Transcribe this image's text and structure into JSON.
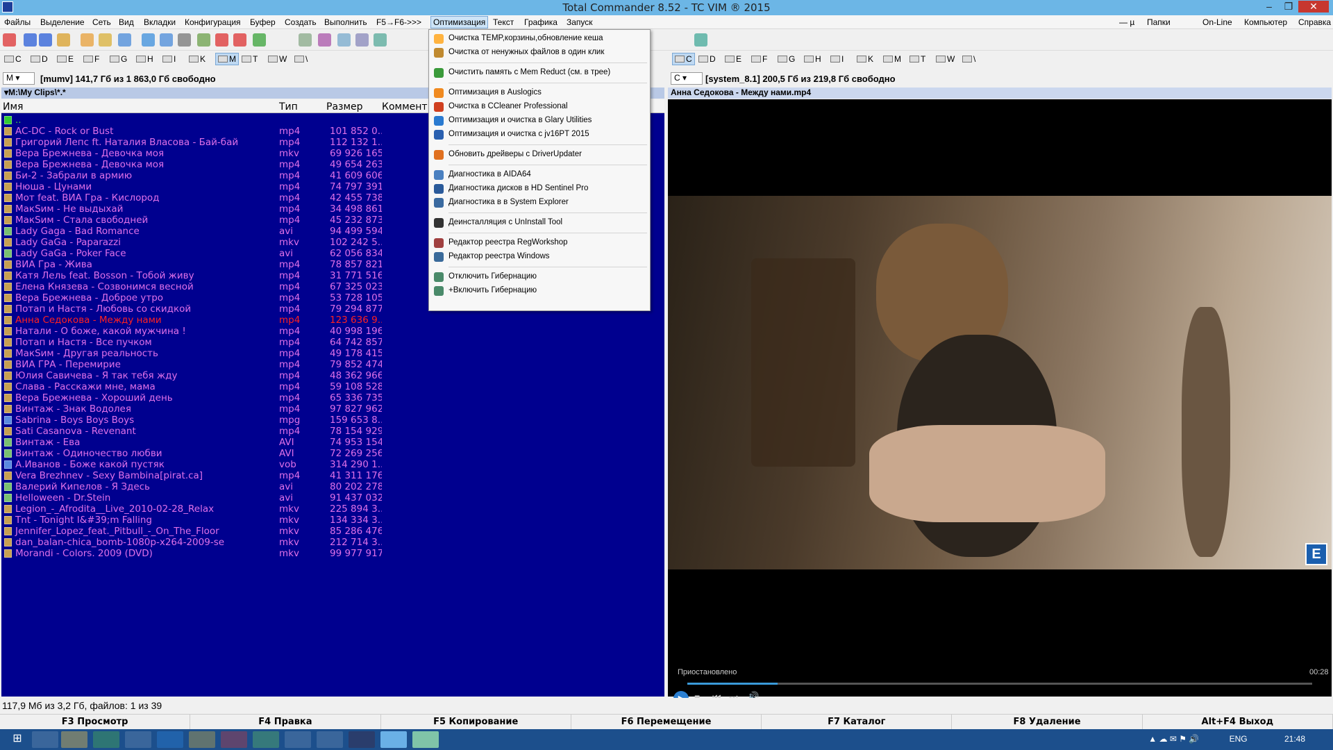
{
  "window": {
    "title": "Total Commander 8.52 - TC VIM ® 2015"
  },
  "menubar": {
    "left": [
      "Файлы",
      "Выделение",
      "Сеть",
      "Вид",
      "Вкладки",
      "Конфигурация",
      "Буфер",
      "Создать",
      "Выполнить",
      "F5→F6->>>",
      "Оптимизация",
      "Текст",
      "Графика",
      "Запуск"
    ],
    "right": [
      "— µ",
      "Папки",
      "On-Line",
      "Компьютер",
      "Справка"
    ]
  },
  "drives_left": [
    "C",
    "D",
    "E",
    "F",
    "G",
    "H",
    "I",
    "K",
    "M",
    "T",
    "W",
    "\\"
  ],
  "drives_right": [
    "C",
    "D",
    "E",
    "F",
    "G",
    "H",
    "I",
    "K",
    "M",
    "T",
    "W",
    "\\"
  ],
  "left_panel": {
    "drive": "M",
    "info": "[mumv]  141,7 Гб из 1 863,0 Гб свободно",
    "path": "▾M:\\My Clips\\*.*",
    "columns": {
      "name": "Имя",
      "type": "Тип",
      "size": "Размер",
      "comment": "Коммент"
    },
    "files": [
      {
        "name": "AC-DC - Rock or Bust",
        "type": "mp4",
        "size": "101 852 0.."
      },
      {
        "name": "Григорий Лепс ft. Наталия Власова - Бай-бай",
        "type": "mp4",
        "size": "112 132 1.."
      },
      {
        "name": "Вера Брежнева - Девочка моя",
        "type": "mkv",
        "size": "69 926 165"
      },
      {
        "name": "Вера Брежнева - Девочка моя",
        "type": "mp4",
        "size": "49 654 263"
      },
      {
        "name": "Би-2 - Забрали в армию",
        "type": "mp4",
        "size": "41 609 606"
      },
      {
        "name": "Нюша - Цунами",
        "type": "mp4",
        "size": "74 797 391"
      },
      {
        "name": "Мот feat. ВИА Гра - Кислород",
        "type": "mp4",
        "size": "42 455 738"
      },
      {
        "name": "МакSим - Не выдыхай",
        "type": "mp4",
        "size": "34 498 861"
      },
      {
        "name": "МакSим - Стала свободней",
        "type": "mp4",
        "size": "45 232 873"
      },
      {
        "name": "Lady Gaga - Bad Romance",
        "type": "avi",
        "size": "94 499 594"
      },
      {
        "name": "Lady GaGa - Paparazzi",
        "type": "mkv",
        "size": "102 242 5.."
      },
      {
        "name": "Lady GaGa - Poker Face",
        "type": "avi",
        "size": "62 056 834"
      },
      {
        "name": "ВИА Гра - Жива",
        "type": "mp4",
        "size": "78 857 821"
      },
      {
        "name": "Катя Лель feat. Bosson - Тобой живу",
        "type": "mp4",
        "size": "31 771 516"
      },
      {
        "name": "Елена Князева - Созвонимся весной",
        "type": "mp4",
        "size": "67 325 023"
      },
      {
        "name": "Вера Брежнева - Доброе утро",
        "type": "mp4",
        "size": "53 728 105"
      },
      {
        "name": "Потап и Настя - Любовь со скидкой",
        "type": "mp4",
        "size": "79 294 877"
      },
      {
        "name": "Анна Седокова - Между нами",
        "type": "mp4",
        "size": "123 636 9.."
      },
      {
        "name": "Натали - О боже, какой мужчина !",
        "type": "mp4",
        "size": "40 998 196"
      },
      {
        "name": "Потап и Настя - Все пучком",
        "type": "mp4",
        "size": "64 742 857"
      },
      {
        "name": "МакSим - Другая реальность",
        "type": "mp4",
        "size": "49 178 415"
      },
      {
        "name": "ВИА ГРА - Перемирие",
        "type": "mp4",
        "size": "79 852 474"
      },
      {
        "name": "Юлия Савичева - Я так тебя жду",
        "type": "mp4",
        "size": "48 362 966"
      },
      {
        "name": "Слава - Расскажи мне, мама",
        "type": "mp4",
        "size": "59 108 528"
      },
      {
        "name": "Вера Брежнева - Хороший день",
        "type": "mp4",
        "size": "65 336 735"
      },
      {
        "name": "Винтаж - Знак Водолея",
        "type": "mp4",
        "size": "97 827 962"
      },
      {
        "name": "Sabrina - Boys Boys Boys",
        "type": "mpg",
        "size": "159 653 8.."
      },
      {
        "name": "Sati Casanova - Revenant",
        "type": "mp4",
        "size": "78 154 929"
      },
      {
        "name": "Винтаж - Ева",
        "type": "AVI",
        "size": "74 953 154"
      },
      {
        "name": "Винтаж - Одиночество любви",
        "type": "AVI",
        "size": "72 269 256"
      },
      {
        "name": "А.Иванов - Боже какой пустяк",
        "type": "vob",
        "size": "314 290 1.."
      },
      {
        "name": "Vera Brezhnev - Sexy Bambina[pirat.ca]",
        "type": "mp4",
        "size": "41 311 176"
      },
      {
        "name": "Валерий Кипелов - Я Здесь",
        "type": "avi",
        "size": "80 202 278"
      },
      {
        "name": "Helloween - Dr.Stein",
        "type": "avi",
        "size": "91 437 032"
      },
      {
        "name": "Legion_-_Afrodita__Live_2010-02-28_Relax",
        "type": "mkv",
        "size": "225 894 3.."
      },
      {
        "name": "Tnt - Tonight I&#39;m Falling",
        "type": "mkv",
        "size": "134 334 3.."
      },
      {
        "name": "Jennifer_Lopez_feat._Pitbull_-_On_The_Floor",
        "type": "mkv",
        "size": "85 286 476"
      },
      {
        "name": "dan_balan-chica_bomb-1080p-x264-2009-se",
        "type": "mkv",
        "size": "212 714 3.."
      },
      {
        "name": "Morandi - Colors. 2009 (DVD)",
        "type": "mkv",
        "size": "99 977 917"
      }
    ],
    "current_index": 17
  },
  "right_panel": {
    "drive": "C",
    "info": "[system_8.1]  200,5 Гб из 219,8 Гб свободно",
    "header": "Анна Седокова - Между нами.mp4",
    "player_status": "Приостановлено",
    "time": "00:28"
  },
  "dropdown": {
    "items": [
      "Очистка TEMP,корзины,обновление кеша",
      "Очистка от ненужных файлов в один клик",
      "Очистить память с Mem Reduct (см. в трее)",
      "Оптимизация в Auslogics",
      "Очистка в CCleaner Professional",
      "Оптимизация и очистка в Glary Utilities",
      "Оптимизация и очистка с jv16PT 2015",
      "Обновить дрейверы с DriverUpdater",
      "Диагностика в AIDA64",
      "Диагностика дисков в HD Sentinel Pro",
      "Диагностика в в System Explorer",
      "Деинсталляция с UnInstall Tool",
      "Редактор реестра RegWorkshop",
      "Редактор реестра Windows",
      "Отключить Гибернацию",
      "+Включить Гибернацию"
    ]
  },
  "status": {
    "text": "117,9 Мб из 3,2 Гб, файлов: 1 из 39"
  },
  "fkeys": [
    "F3 Просмотр",
    "F4 Правка",
    "F5 Копирование",
    "F6 Перемещение",
    "F7 Каталог",
    "F8 Удаление",
    "Alt+F4 Выход"
  ],
  "taskbar": {
    "lang": "ENG",
    "clock": "21:48"
  },
  "colors": {
    "panel_bg": "#00008f",
    "file_text": "#e070e8",
    "cursor_text": "#ff2020",
    "title_bg": "#6cb6e6",
    "taskbar_bg": "#1c4f8c"
  }
}
